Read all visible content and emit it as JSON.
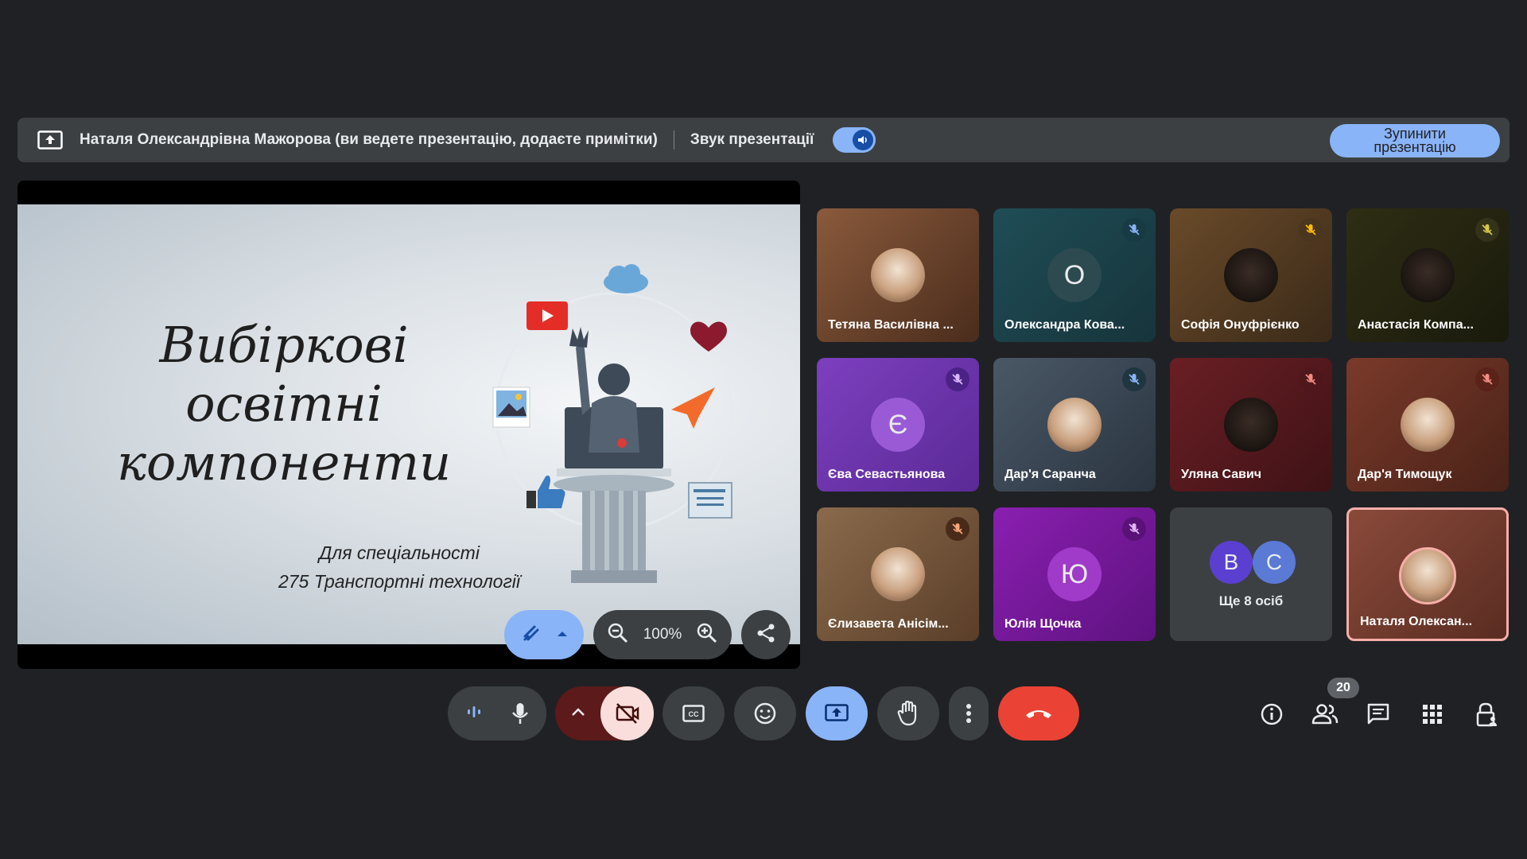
{
  "present_bar": {
    "presenter_text": "Наталя Олександрівна Мажорова (ви ведете презентацію, додаєте примітки)",
    "audio_label": "Звук презентації",
    "stop_label": "Зупинити презентацію"
  },
  "slide": {
    "title_lines": [
      "Вибіркові",
      "освітні",
      "компоненти"
    ],
    "subtitle_lines": [
      "Для спеціальності",
      "275 Транспортні технології"
    ]
  },
  "slide_controls": {
    "zoom_value": "100%"
  },
  "participants": [
    {
      "name": "Тетяна Василівна ...",
      "initial": "",
      "muted": false
    },
    {
      "name": "Олександра Кова...",
      "initial": "О",
      "muted": true
    },
    {
      "name": "Софія Онуфрієнко",
      "initial": "",
      "muted": true
    },
    {
      "name": "Анастасія Компа...",
      "initial": "",
      "muted": true
    },
    {
      "name": "Єва Севастьянова",
      "initial": "Є",
      "muted": true
    },
    {
      "name": "Дар'я Саранча",
      "initial": "",
      "muted": true
    },
    {
      "name": "Уляна Савич",
      "initial": "",
      "muted": true
    },
    {
      "name": "Дар'я Тимощук",
      "initial": "",
      "muted": true
    },
    {
      "name": "Єлизавета Анісім...",
      "initial": "",
      "muted": true
    },
    {
      "name": "Юлія Щочка",
      "initial": "Ю",
      "muted": true
    },
    {
      "name": "Ще 8 осіб",
      "initial": "",
      "muted": false
    },
    {
      "name": "Наталя Олексан...",
      "initial": "",
      "muted": false
    }
  ],
  "more_tile": {
    "initials": [
      "В",
      "С"
    ],
    "label": "Ще 8 осіб"
  },
  "people_count": "20",
  "colors": {
    "bg": "#202124",
    "accent": "#8ab4f8",
    "end_call": "#ea4335",
    "camera_off": "#f9dedc"
  }
}
